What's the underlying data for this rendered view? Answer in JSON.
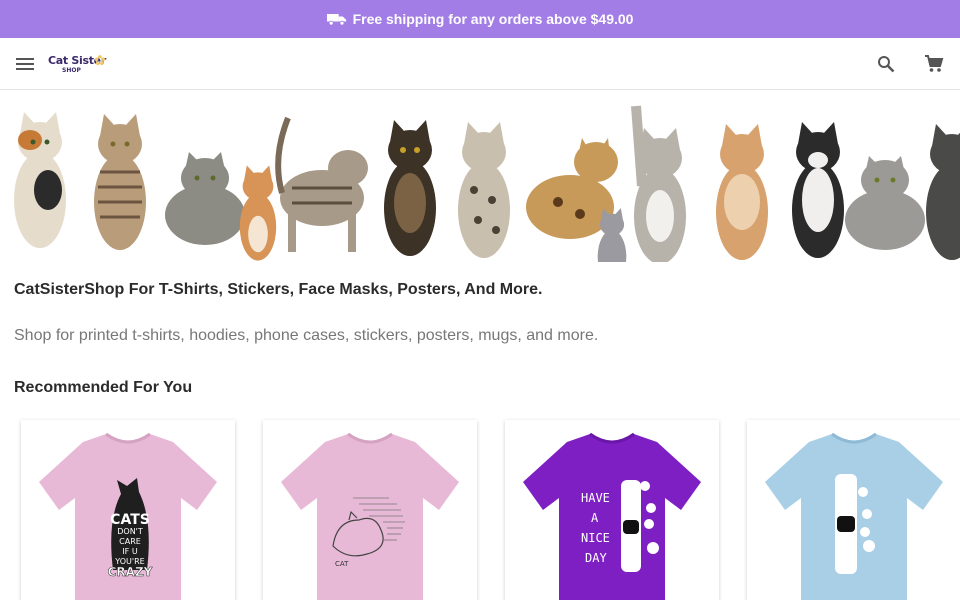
{
  "promo": {
    "text": "Free shipping for any orders above $49.00",
    "icon": "truck-icon",
    "background": "#a27de6"
  },
  "header": {
    "menu_icon": "menu-icon",
    "logo_line1": "Cat Sister",
    "logo_line2": "SHOP",
    "search_icon": "search-icon",
    "cart_icon": "cart-icon"
  },
  "main": {
    "headline": "CatSisterShop For T-Shirts, Stickers, Face Masks, Posters, And More.",
    "subline": "Shop for printed t-shirts, hoodies, phone cases, stickers, posters, mugs, and more.",
    "recommended_title": "Recommended For You"
  },
  "products": [
    {
      "shirt_color": "#e7b9d6",
      "design": "CATS DON'T CARE IF U YOU'RE CRAZY"
    },
    {
      "shirt_color": "#e7b9d6",
      "design": "CAT"
    },
    {
      "shirt_color": "#7e1fc4",
      "design": "HAVE A NICE DAY"
    },
    {
      "shirt_color": "#a9cfe6",
      "design": ""
    }
  ]
}
